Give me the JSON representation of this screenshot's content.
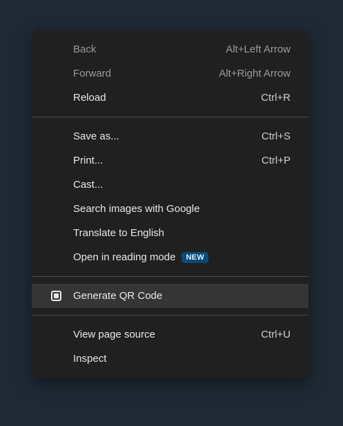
{
  "menu": {
    "items": [
      {
        "label": "Back",
        "shortcut": "Alt+Left Arrow",
        "disabled": true
      },
      {
        "label": "Forward",
        "shortcut": "Alt+Right Arrow",
        "disabled": true
      },
      {
        "label": "Reload",
        "shortcut": "Ctrl+R"
      },
      {
        "label": "Save as...",
        "shortcut": "Ctrl+S"
      },
      {
        "label": "Print...",
        "shortcut": "Ctrl+P"
      },
      {
        "label": "Cast..."
      },
      {
        "label": "Search images with Google"
      },
      {
        "label": "Translate to English"
      },
      {
        "label": "Open in reading mode",
        "badge": "NEW"
      },
      {
        "label": "Generate QR Code",
        "icon": "qr-code-icon",
        "highlighted": true
      },
      {
        "label": "View page source",
        "shortcut": "Ctrl+U"
      },
      {
        "label": "Inspect"
      }
    ]
  },
  "colors": {
    "page_background": "#1f2935",
    "menu_background": "#202020",
    "highlight": "#353535",
    "badge_background": "#0b4a76"
  }
}
